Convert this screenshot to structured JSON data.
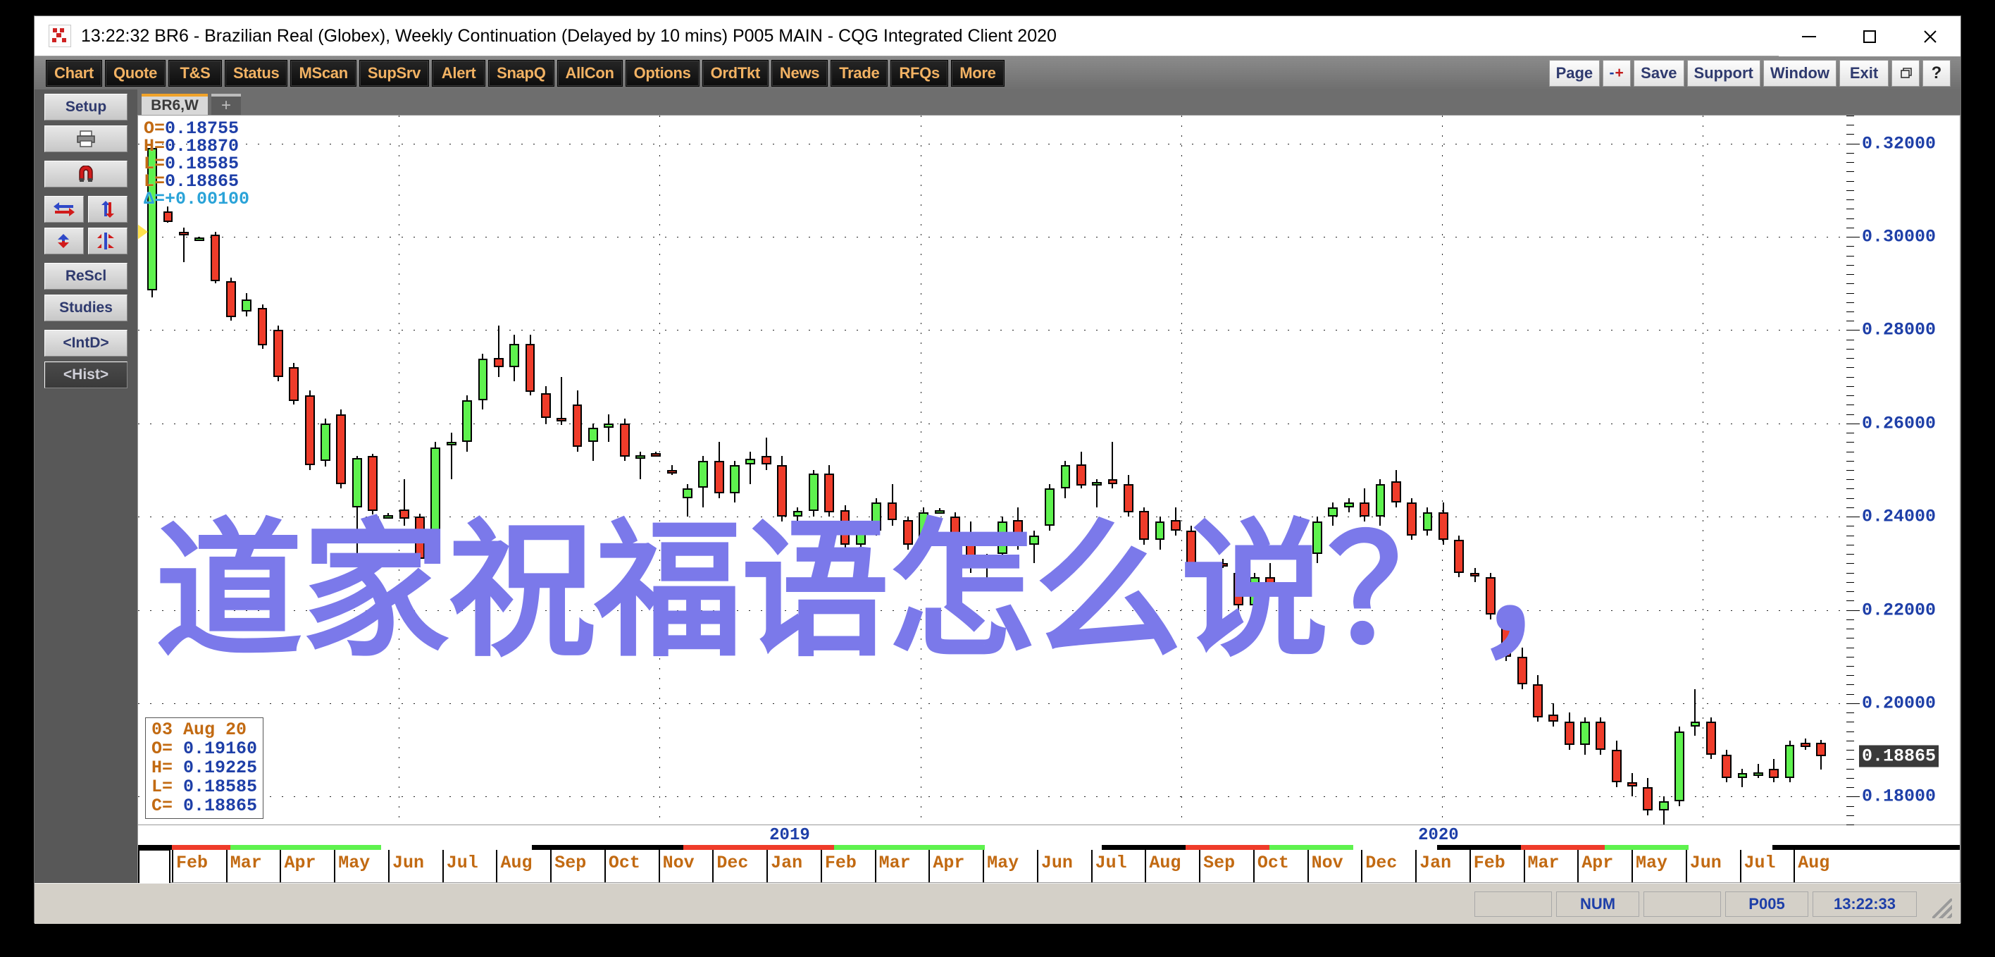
{
  "window": {
    "title": "13:22:32   BR6 - Brazilian Real (Globex), Weekly Continuation (Delayed by 10 mins)   P005 MAIN - CQG Integrated Client 2020",
    "clock": "13:22:32",
    "minimize_label": "minimize",
    "maximize_label": "maximize",
    "close_label": "close"
  },
  "toolbar": {
    "left_buttons": [
      "Chart",
      "Quote",
      "T&S",
      "Status",
      "MScan",
      "SupSrv",
      "Alert",
      "SnapQ",
      "AllCon",
      "Options",
      "OrdTkt",
      "News",
      "Trade",
      "RFQs",
      "More"
    ],
    "right_buttons": [
      "Page",
      "Save",
      "Support",
      "Window",
      "Exit"
    ],
    "zoom_minus": "-",
    "zoom_plus": "+",
    "restore_label": "restore-window",
    "help_label": "?"
  },
  "left_rail": {
    "setup": "Setup",
    "print_icon": "printer-icon",
    "magnet_icon": "magnet-icon",
    "arrows_icon_1": "horizontal-arrows-icon",
    "arrows_icon_2": "vertical-arrows-icon",
    "arrows_icon_3": "converge-arrows-icon",
    "arrows_icon_4": "split-arrows-icon",
    "rescale": "ReScl",
    "studies": "Studies",
    "intraday": "<IntD>",
    "history": "<Hist>"
  },
  "tabs": {
    "active": "BR6,W",
    "add": "+"
  },
  "quote_top": {
    "open_label": "O=",
    "open": "0.18755",
    "high_label": "H=",
    "high": "0.18870",
    "low_label": "L=",
    "low": "0.18585",
    "last_label": "L=",
    "last": "0.18865",
    "delta_label": "Δ=",
    "delta": "+0.00100"
  },
  "quote_box": {
    "date": "03 Aug 20",
    "open_label": "O=",
    "open": "0.19160",
    "high_label": "H=",
    "high": "0.19225",
    "low_label": "L=",
    "low": "0.18585",
    "close_label": "C=",
    "close": "0.18865"
  },
  "overlay": {
    "text": "道家祝福语怎么说？，",
    "color": "#7b79ea"
  },
  "status_bar": {
    "num": "NUM",
    "page": "P005",
    "time": "13:22:33"
  },
  "chart_data": {
    "type": "candlestick",
    "title": "BR6 - Brazilian Real (Globex), Weekly Continuation",
    "xlabel": "",
    "ylabel": "",
    "ylim": [
      0.174,
      0.326
    ],
    "grid": true,
    "last_price": "0.18865",
    "y_ticks": [
      "0.32000",
      "0.30000",
      "0.28000",
      "0.26000",
      "0.24000",
      "0.22000",
      "0.20000",
      "0.18000"
    ],
    "y_tick_values": [
      0.32,
      0.3,
      0.28,
      0.26,
      0.24,
      0.22,
      0.2,
      0.18
    ],
    "year_labels": [
      "2019",
      "2020"
    ],
    "months": [
      "Feb",
      "Mar",
      "Apr",
      "May",
      "Jun",
      "Jul",
      "Aug",
      "Sep",
      "Oct",
      "Nov",
      "Dec",
      "Jan",
      "Feb",
      "Mar",
      "Apr",
      "May",
      "Jun",
      "Jul",
      "Aug",
      "Sep",
      "Oct",
      "Nov",
      "Dec",
      "Jan",
      "Feb",
      "Mar",
      "Apr",
      "May",
      "Jun",
      "Jul",
      "Aug"
    ],
    "season_segments": [
      {
        "color": "#ef3c2a",
        "start": 0.0,
        "end": 0.035
      },
      {
        "color": "#5ef24e",
        "start": 0.035,
        "end": 0.125
      },
      {
        "color": "#ffffff",
        "start": 0.125,
        "end": 0.215
      },
      {
        "color": "#000000",
        "start": 0.215,
        "end": 0.305
      },
      {
        "color": "#ef3c2a",
        "start": 0.305,
        "end": 0.395
      },
      {
        "color": "#5ef24e",
        "start": 0.395,
        "end": 0.485
      },
      {
        "color": "#ffffff",
        "start": 0.485,
        "end": 0.555
      },
      {
        "color": "#000000",
        "start": 0.555,
        "end": 0.605
      },
      {
        "color": "#ef3c2a",
        "start": 0.605,
        "end": 0.655
      },
      {
        "color": "#5ef24e",
        "start": 0.655,
        "end": 0.705
      },
      {
        "color": "#ffffff",
        "start": 0.705,
        "end": 0.755
      },
      {
        "color": "#000000",
        "start": 0.755,
        "end": 0.805
      },
      {
        "color": "#ef3c2a",
        "start": 0.805,
        "end": 0.855
      },
      {
        "color": "#5ef24e",
        "start": 0.855,
        "end": 0.905
      },
      {
        "color": "#ffffff",
        "start": 0.905,
        "end": 0.955
      },
      {
        "color": "#000000",
        "start": 0.955,
        "end": 1.0
      }
    ],
    "bars": [
      {
        "o": 0.2886,
        "h": 0.3196,
        "l": 0.287,
        "c": 0.319
      },
      {
        "o": 0.3055,
        "h": 0.3065,
        "l": 0.303,
        "c": 0.3032
      },
      {
        "o": 0.301,
        "h": 0.302,
        "l": 0.2945,
        "c": 0.3008
      },
      {
        "o": 0.2997,
        "h": 0.3,
        "l": 0.2997,
        "c": 0.2999
      },
      {
        "o": 0.3005,
        "h": 0.301,
        "l": 0.29,
        "c": 0.2905
      },
      {
        "o": 0.2905,
        "h": 0.2912,
        "l": 0.282,
        "c": 0.2828
      },
      {
        "o": 0.284,
        "h": 0.288,
        "l": 0.283,
        "c": 0.2865
      },
      {
        "o": 0.2848,
        "h": 0.2855,
        "l": 0.276,
        "c": 0.2768
      },
      {
        "o": 0.28,
        "h": 0.281,
        "l": 0.269,
        "c": 0.27
      },
      {
        "o": 0.272,
        "h": 0.273,
        "l": 0.264,
        "c": 0.2648
      },
      {
        "o": 0.266,
        "h": 0.267,
        "l": 0.25,
        "c": 0.251
      },
      {
        "o": 0.252,
        "h": 0.261,
        "l": 0.2508,
        "c": 0.26
      },
      {
        "o": 0.262,
        "h": 0.263,
        "l": 0.246,
        "c": 0.247
      },
      {
        "o": 0.242,
        "h": 0.253,
        "l": 0.23,
        "c": 0.2525
      },
      {
        "o": 0.253,
        "h": 0.2535,
        "l": 0.2405,
        "c": 0.2412
      },
      {
        "o": 0.24,
        "h": 0.2408,
        "l": 0.2398,
        "c": 0.2404
      },
      {
        "o": 0.2415,
        "h": 0.248,
        "l": 0.238,
        "c": 0.2395
      },
      {
        "o": 0.24,
        "h": 0.2406,
        "l": 0.2306,
        "c": 0.231
      },
      {
        "o": 0.236,
        "h": 0.256,
        "l": 0.235,
        "c": 0.2548
      },
      {
        "o": 0.256,
        "h": 0.258,
        "l": 0.248,
        "c": 0.256
      },
      {
        "o": 0.256,
        "h": 0.266,
        "l": 0.254,
        "c": 0.265
      },
      {
        "o": 0.265,
        "h": 0.275,
        "l": 0.263,
        "c": 0.2738
      },
      {
        "o": 0.274,
        "h": 0.281,
        "l": 0.27,
        "c": 0.272
      },
      {
        "o": 0.272,
        "h": 0.279,
        "l": 0.269,
        "c": 0.277
      },
      {
        "o": 0.277,
        "h": 0.279,
        "l": 0.266,
        "c": 0.2668
      },
      {
        "o": 0.2665,
        "h": 0.268,
        "l": 0.26,
        "c": 0.2612
      },
      {
        "o": 0.2612,
        "h": 0.27,
        "l": 0.2596,
        "c": 0.261
      },
      {
        "o": 0.264,
        "h": 0.267,
        "l": 0.254,
        "c": 0.255
      },
      {
        "o": 0.256,
        "h": 0.26,
        "l": 0.252,
        "c": 0.259
      },
      {
        "o": 0.259,
        "h": 0.262,
        "l": 0.256,
        "c": 0.26
      },
      {
        "o": 0.26,
        "h": 0.261,
        "l": 0.252,
        "c": 0.2528
      },
      {
        "o": 0.253,
        "h": 0.254,
        "l": 0.248,
        "c": 0.2532
      },
      {
        "o": 0.2536,
        "h": 0.254,
        "l": 0.2532,
        "c": 0.2534
      },
      {
        "o": 0.25,
        "h": 0.251,
        "l": 0.249,
        "c": 0.2494
      },
      {
        "o": 0.244,
        "h": 0.247,
        "l": 0.24,
        "c": 0.246
      },
      {
        "o": 0.2462,
        "h": 0.253,
        "l": 0.242,
        "c": 0.252
      },
      {
        "o": 0.252,
        "h": 0.256,
        "l": 0.244,
        "c": 0.245
      },
      {
        "o": 0.245,
        "h": 0.252,
        "l": 0.243,
        "c": 0.251
      },
      {
        "o": 0.2512,
        "h": 0.254,
        "l": 0.247,
        "c": 0.2524
      },
      {
        "o": 0.253,
        "h": 0.257,
        "l": 0.25,
        "c": 0.2512
      },
      {
        "o": 0.251,
        "h": 0.253,
        "l": 0.239,
        "c": 0.24
      },
      {
        "o": 0.24,
        "h": 0.242,
        "l": 0.237,
        "c": 0.2412
      },
      {
        "o": 0.2412,
        "h": 0.25,
        "l": 0.24,
        "c": 0.2492
      },
      {
        "o": 0.2492,
        "h": 0.251,
        "l": 0.24,
        "c": 0.241
      },
      {
        "o": 0.2414,
        "h": 0.2425,
        "l": 0.233,
        "c": 0.234
      },
      {
        "o": 0.234,
        "h": 0.238,
        "l": 0.23,
        "c": 0.237
      },
      {
        "o": 0.237,
        "h": 0.244,
        "l": 0.236,
        "c": 0.243
      },
      {
        "o": 0.243,
        "h": 0.247,
        "l": 0.238,
        "c": 0.2392
      },
      {
        "o": 0.2392,
        "h": 0.24,
        "l": 0.233,
        "c": 0.234
      },
      {
        "o": 0.235,
        "h": 0.242,
        "l": 0.234,
        "c": 0.241
      },
      {
        "o": 0.2412,
        "h": 0.2418,
        "l": 0.2406,
        "c": 0.2414
      },
      {
        "o": 0.24,
        "h": 0.241,
        "l": 0.234,
        "c": 0.235
      },
      {
        "o": 0.235,
        "h": 0.239,
        "l": 0.228,
        "c": 0.229
      },
      {
        "o": 0.229,
        "h": 0.232,
        "l": 0.225,
        "c": 0.231
      },
      {
        "o": 0.232,
        "h": 0.24,
        "l": 0.23,
        "c": 0.239
      },
      {
        "o": 0.2392,
        "h": 0.242,
        "l": 0.233,
        "c": 0.234
      },
      {
        "o": 0.234,
        "h": 0.237,
        "l": 0.23,
        "c": 0.236
      },
      {
        "o": 0.238,
        "h": 0.247,
        "l": 0.237,
        "c": 0.246
      },
      {
        "o": 0.246,
        "h": 0.252,
        "l": 0.244,
        "c": 0.251
      },
      {
        "o": 0.2512,
        "h": 0.254,
        "l": 0.246,
        "c": 0.2466
      },
      {
        "o": 0.247,
        "h": 0.248,
        "l": 0.242,
        "c": 0.2474
      },
      {
        "o": 0.248,
        "h": 0.256,
        "l": 0.246,
        "c": 0.247
      },
      {
        "o": 0.247,
        "h": 0.249,
        "l": 0.24,
        "c": 0.241
      },
      {
        "o": 0.2412,
        "h": 0.242,
        "l": 0.234,
        "c": 0.235
      },
      {
        "o": 0.235,
        "h": 0.24,
        "l": 0.233,
        "c": 0.239
      },
      {
        "o": 0.2392,
        "h": 0.242,
        "l": 0.236,
        "c": 0.237
      },
      {
        "o": 0.237,
        "h": 0.238,
        "l": 0.227,
        "c": 0.228
      },
      {
        "o": 0.2286,
        "h": 0.23,
        "l": 0.2282,
        "c": 0.2292
      },
      {
        "o": 0.23,
        "h": 0.231,
        "l": 0.229,
        "c": 0.2295
      },
      {
        "o": 0.228,
        "h": 0.23,
        "l": 0.22,
        "c": 0.221
      },
      {
        "o": 0.221,
        "h": 0.228,
        "l": 0.218,
        "c": 0.227
      },
      {
        "o": 0.227,
        "h": 0.23,
        "l": 0.224,
        "c": 0.225
      },
      {
        "o": 0.22,
        "h": 0.226,
        "l": 0.218,
        "c": 0.225
      },
      {
        "o": 0.225,
        "h": 0.232,
        "l": 0.224,
        "c": 0.231
      },
      {
        "o": 0.232,
        "h": 0.24,
        "l": 0.23,
        "c": 0.239
      },
      {
        "o": 0.24,
        "h": 0.243,
        "l": 0.238,
        "c": 0.242
      },
      {
        "o": 0.242,
        "h": 0.244,
        "l": 0.241,
        "c": 0.243
      },
      {
        "o": 0.243,
        "h": 0.246,
        "l": 0.239,
        "c": 0.24
      },
      {
        "o": 0.24,
        "h": 0.248,
        "l": 0.238,
        "c": 0.247
      },
      {
        "o": 0.2476,
        "h": 0.25,
        "l": 0.242,
        "c": 0.243
      },
      {
        "o": 0.243,
        "h": 0.244,
        "l": 0.235,
        "c": 0.236
      },
      {
        "o": 0.237,
        "h": 0.242,
        "l": 0.236,
        "c": 0.241
      },
      {
        "o": 0.241,
        "h": 0.243,
        "l": 0.234,
        "c": 0.235
      },
      {
        "o": 0.235,
        "h": 0.236,
        "l": 0.227,
        "c": 0.228
      },
      {
        "o": 0.228,
        "h": 0.229,
        "l": 0.226,
        "c": 0.2272
      },
      {
        "o": 0.227,
        "h": 0.228,
        "l": 0.218,
        "c": 0.219
      },
      {
        "o": 0.219,
        "h": 0.22,
        "l": 0.209,
        "c": 0.21
      },
      {
        "o": 0.21,
        "h": 0.212,
        "l": 0.203,
        "c": 0.204
      },
      {
        "o": 0.204,
        "h": 0.206,
        "l": 0.196,
        "c": 0.197
      },
      {
        "o": 0.1975,
        "h": 0.2,
        "l": 0.195,
        "c": 0.196
      },
      {
        "o": 0.196,
        "h": 0.198,
        "l": 0.19,
        "c": 0.191
      },
      {
        "o": 0.191,
        "h": 0.197,
        "l": 0.189,
        "c": 0.196
      },
      {
        "o": 0.196,
        "h": 0.197,
        "l": 0.189,
        "c": 0.19
      },
      {
        "o": 0.19,
        "h": 0.192,
        "l": 0.182,
        "c": 0.183
      },
      {
        "o": 0.183,
        "h": 0.185,
        "l": 0.18,
        "c": 0.1822
      },
      {
        "o": 0.182,
        "h": 0.184,
        "l": 0.176,
        "c": 0.177
      },
      {
        "o": 0.177,
        "h": 0.18,
        "l": 0.174,
        "c": 0.179
      },
      {
        "o": 0.179,
        "h": 0.195,
        "l": 0.178,
        "c": 0.194
      },
      {
        "o": 0.195,
        "h": 0.203,
        "l": 0.193,
        "c": 0.196
      },
      {
        "o": 0.196,
        "h": 0.197,
        "l": 0.188,
        "c": 0.189
      },
      {
        "o": 0.189,
        "h": 0.19,
        "l": 0.183,
        "c": 0.184
      },
      {
        "o": 0.184,
        "h": 0.186,
        "l": 0.182,
        "c": 0.185
      },
      {
        "o": 0.1848,
        "h": 0.187,
        "l": 0.184,
        "c": 0.1852
      },
      {
        "o": 0.186,
        "h": 0.188,
        "l": 0.183,
        "c": 0.184
      },
      {
        "o": 0.184,
        "h": 0.192,
        "l": 0.183,
        "c": 0.191
      },
      {
        "o": 0.1916,
        "h": 0.1925,
        "l": 0.19,
        "c": 0.1906
      },
      {
        "o": 0.1916,
        "h": 0.1922,
        "l": 0.1858,
        "c": 0.1886
      }
    ]
  }
}
